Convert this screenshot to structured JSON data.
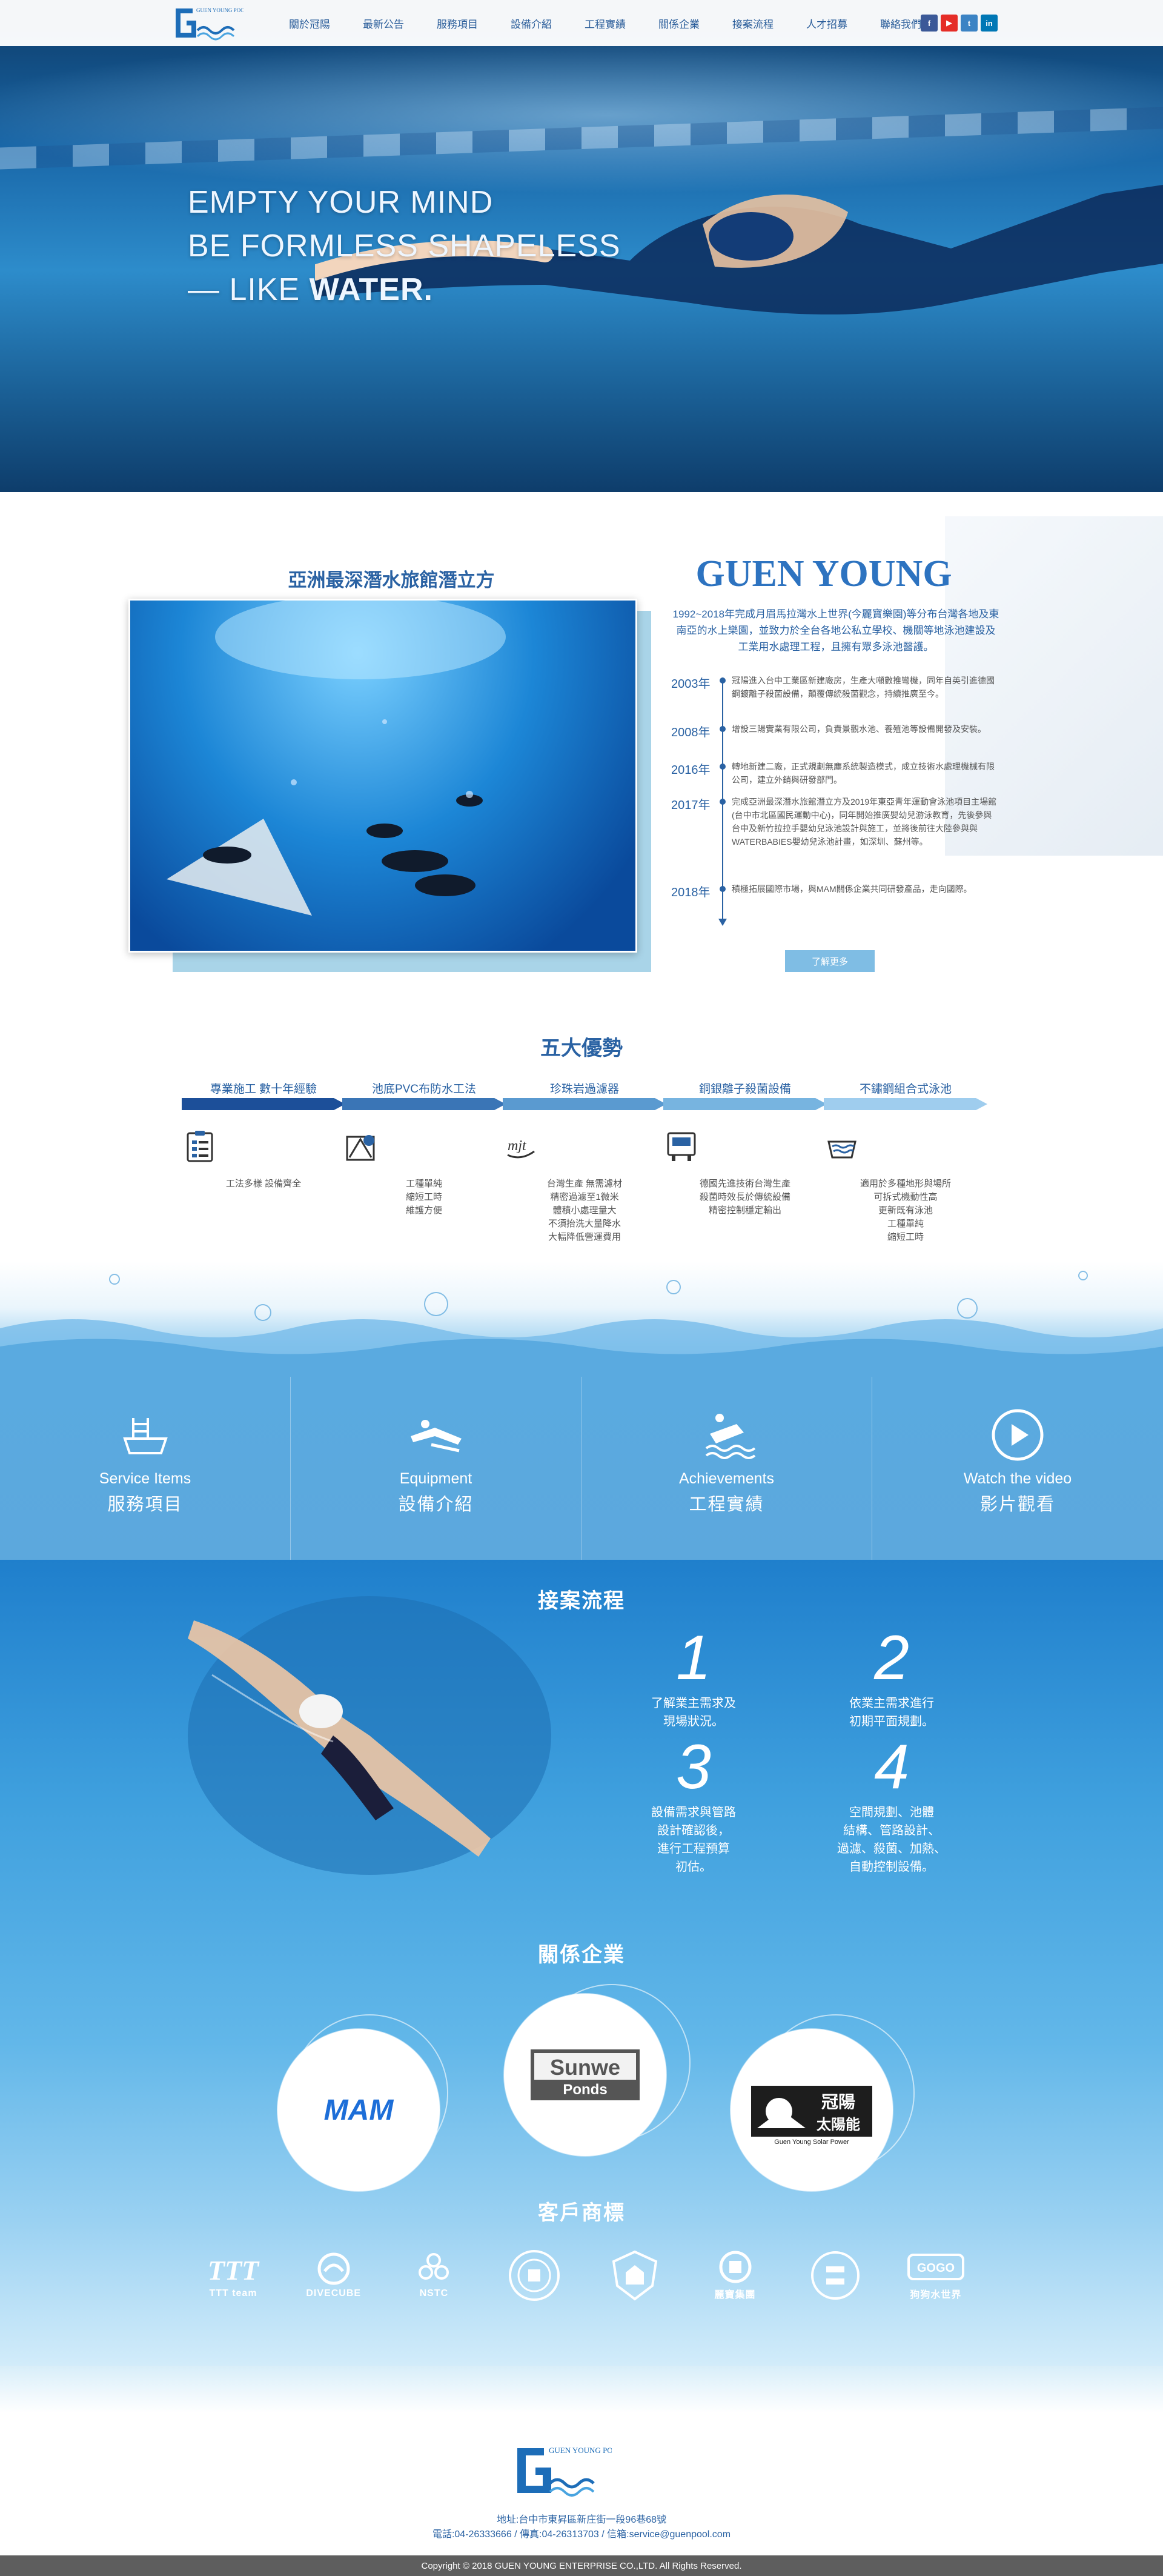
{
  "brand": {
    "logo_text": "GUEN YOUNG POOLS",
    "name": "GUEN YOUNG"
  },
  "nav": {
    "items": [
      "關於冠陽",
      "最新公告",
      "服務項目",
      "設備介紹",
      "工程實績",
      "關係企業",
      "接案流程",
      "人才招募",
      "聯絡我們"
    ],
    "socials": [
      {
        "label": "f",
        "color": "#3b5998"
      },
      {
        "label": "▶",
        "color": "#e52d27"
      },
      {
        "label": "t",
        "color": "#3b83c4"
      },
      {
        "label": "in",
        "color": "#0077b5"
      }
    ]
  },
  "hero": {
    "line1": "EMPTY YOUR MIND",
    "line2": "BE FORMLESS SHAPELESS",
    "line3_prefix": "— LIKE",
    "line3_strong": "WATER."
  },
  "about": {
    "photo_title": "亞洲最深潛水旅館潛立方",
    "description": "1992~2018年完成月眉馬拉灣水上世界(今麗寶樂園)等分布台灣各地及東南亞的水上樂園，並致力於全台各地公私立學校、機關等地泳池建設及工業用水處理工程，且擁有眾多泳池醫護。",
    "timeline": [
      {
        "year": "2003年",
        "text": "冠陽進入台中工業區新建廠房，生產大噸數推彎機，同年自英引進德國鋼鍍離子殺菌設備，顛覆傳統殺菌觀念，持續推廣至今。"
      },
      {
        "year": "2008年",
        "text": "增設三陽實業有限公司，負責景觀水池、養殖池等設備開發及安裝。"
      },
      {
        "year": "2016年",
        "text": "轉地新建二廠，正式規劃無塵系統製造模式，成立技術水處理機械有限公司，建立外銷與研發部門。"
      },
      {
        "year": "2017年",
        "text": "完成亞洲最深潛水旅館潛立方及2019年東亞青年運動會泳池項目主場館(台中市北區國民運動中心)，同年開始推廣嬰幼兒游泳教育，先後參與台中及新竹拉拉手嬰幼兒泳池設計與施工，並將後前往大陸參與與 WATERBABIES嬰幼兒泳池計畫，如深圳、蘇州等。"
      },
      {
        "year": "2018年",
        "text": "積極拓展國際市場，與MAM關係企業共同研發產品，走向國際。"
      }
    ],
    "more_label": "了解更多"
  },
  "advantages": {
    "title": "五大優勢",
    "items": [
      {
        "label": "專業施工 數十年經驗",
        "desc": "工法多樣 設備齊全",
        "color": "#1c4f99",
        "icon": "clipboard-icon"
      },
      {
        "label": "池底PVC布防水工法",
        "desc": "工種單純\n縮短工時\n維護方便",
        "color": "#3a75b6",
        "icon": "pvc-roll-icon"
      },
      {
        "label": "珍珠岩過濾器",
        "desc": "台灣生產 無需濾材\n精密過濾至1微米\n體積小處理量大\n不須抬洗大量降水\n大幅降低營運費用",
        "color": "#5a9ad0",
        "icon": "mjt-logo-icon"
      },
      {
        "label": "銅銀離子殺菌設備",
        "desc": "德國先進技術台灣生產\n殺菌時效長於傳統設備\n精密控制穩定輸出",
        "color": "#77b4e0",
        "icon": "ion-device-icon"
      },
      {
        "label": "不鏽鋼組合式泳池",
        "desc": "適用於多種地形與場所\n可拆式機動性高\n更新既有泳池\n工種單純\n縮短工時",
        "color": "#9fcdee",
        "icon": "steel-pool-icon"
      }
    ]
  },
  "services": [
    {
      "en": "Service  Items",
      "zh": "服務項目",
      "icon": "pool-ladder-icon"
    },
    {
      "en": "Equipment",
      "zh": "設備介紹",
      "icon": "swimmer-icon"
    },
    {
      "en": "Achievements",
      "zh": "工程實績",
      "icon": "float-board-icon"
    },
    {
      "en": "Watch the video",
      "zh": "影片觀看",
      "icon": "play-icon"
    }
  ],
  "process": {
    "title": "接案流程",
    "steps": [
      {
        "num": "1",
        "text": "了解業主需求及\n現場狀況。"
      },
      {
        "num": "2",
        "text": "依業主需求進行\n初期平面規劃。"
      },
      {
        "num": "3",
        "text": "設備需求與管路\n設計確認後，\n進行工程預算\n初估。"
      },
      {
        "num": "4",
        "text": "空間規劃、池體\n結構、管路設計、\n過濾、殺菌、加熱、\n自動控制設備。"
      }
    ]
  },
  "partners": {
    "title": "關係企業",
    "items": [
      {
        "name": "MAM"
      },
      {
        "name": "Sunwe Ponds",
        "line1": "Sunwe",
        "line2": "Ponds"
      },
      {
        "name": "冠陽太陽能",
        "line1": "冠陽",
        "line2": "太陽能",
        "sub": "Guen Young Solar Power"
      }
    ]
  },
  "clients": {
    "title": "客戶商標",
    "items": [
      {
        "text": "TTT team"
      },
      {
        "text": "DIVECUBE"
      },
      {
        "text": "NSTC"
      },
      {
        "text": ""
      },
      {
        "text": ""
      },
      {
        "text": "麗寶集團"
      },
      {
        "text": ""
      },
      {
        "text": "狗狗水世界"
      }
    ]
  },
  "footer": {
    "address": "地址:台中市東昇區新庄街一段96巷68號",
    "contact": "電話:04-26333666 / 傳真:04-26313703 / 信箱:service@guenpool.com",
    "copyright": "Copyright © 2018 GUEN YOUNG ENTERPRISE CO.,LTD. All Rights Reserved."
  },
  "colors": {
    "primary": "#2a62a3",
    "accent": "#7fbde4",
    "service_bg": "#5aaae0",
    "footer_bar": "#5e5e5e"
  }
}
